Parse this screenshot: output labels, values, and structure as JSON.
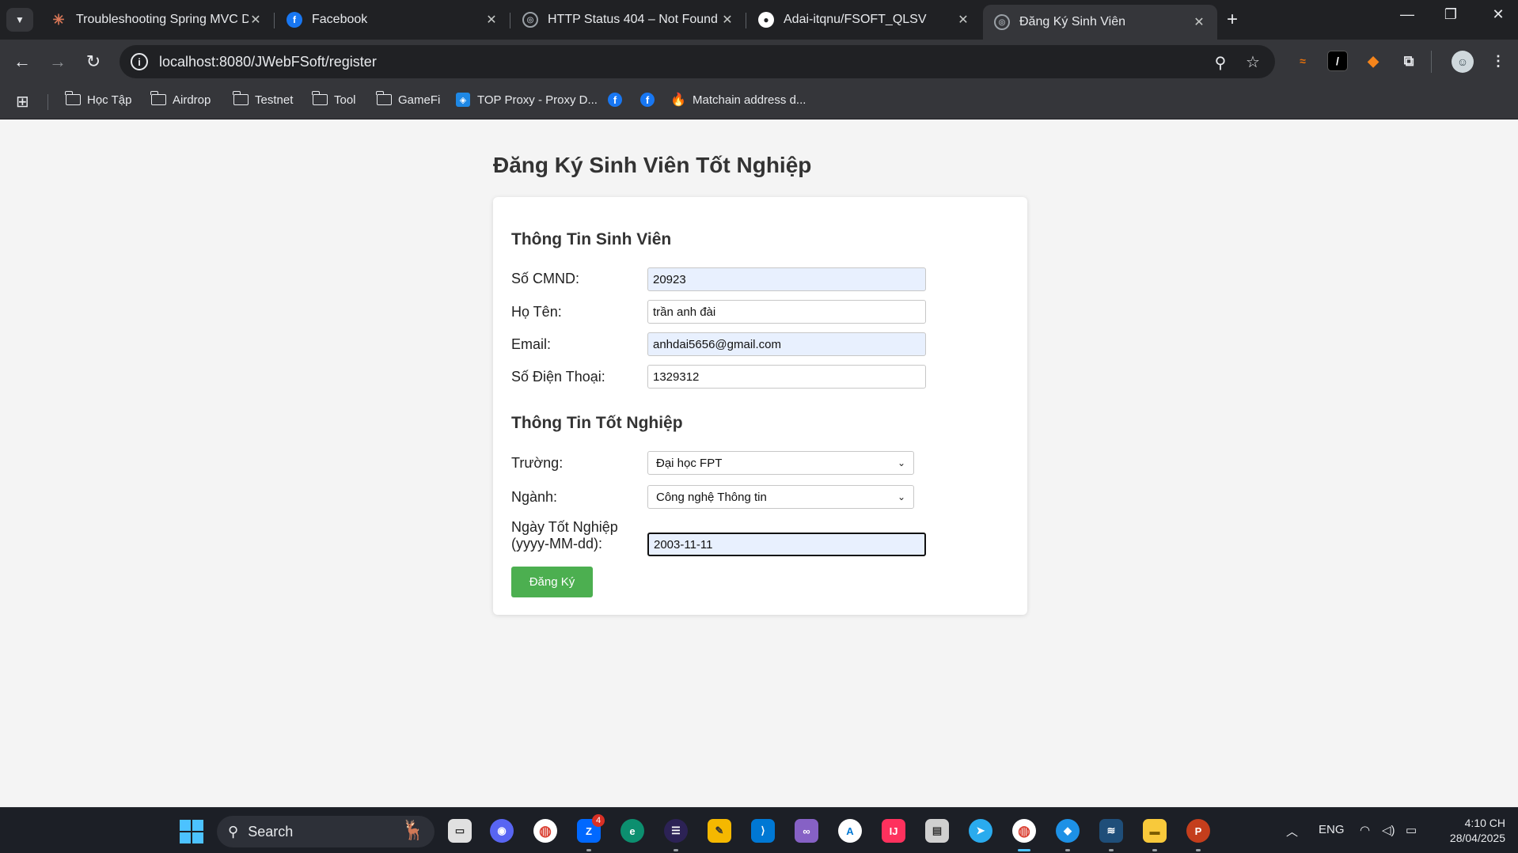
{
  "browser": {
    "tabs": [
      {
        "title": "Troubleshooting Spring MVC D",
        "icon": "claude-icon",
        "color": "#d97757",
        "active": false
      },
      {
        "title": "Facebook",
        "icon": "facebook-icon",
        "color": "#1877f2",
        "active": false
      },
      {
        "title": "HTTP Status 404 – Not Found",
        "icon": "globe-icon",
        "color": "#9aa0a6",
        "active": false
      },
      {
        "title": "Adai-itqnu/FSOFT_QLSV",
        "icon": "github-icon",
        "color": "#ffffff",
        "active": false
      },
      {
        "title": "Đăng Ký Sinh Viên",
        "icon": "globe-icon",
        "color": "#9aa0a6",
        "active": true
      }
    ],
    "address": "localhost:8080/JWebFSoft/register",
    "bookmarks": [
      {
        "label": "Học Tập",
        "icon": "folder-icon"
      },
      {
        "label": "Airdrop",
        "icon": "folder-icon"
      },
      {
        "label": "Testnet",
        "icon": "folder-icon"
      },
      {
        "label": "Tool",
        "icon": "folder-icon"
      },
      {
        "label": "GameFi",
        "icon": "folder-icon"
      },
      {
        "label": "TOP Proxy - Proxy D...",
        "icon": "shield-icon"
      },
      {
        "label": "",
        "icon": "facebook-icon"
      },
      {
        "label": "",
        "icon": "facebook-icon"
      },
      {
        "label": "Matchain address d...",
        "icon": "fire-icon"
      }
    ]
  },
  "page": {
    "title": "Đăng Ký Sinh Viên Tốt Nghiệp",
    "student_section": "Thông Tin Sinh Viên",
    "fields": {
      "cmnd": {
        "label": "Số CMND:",
        "value": "20923"
      },
      "name": {
        "label": "Họ Tên:",
        "value": "trần anh đài"
      },
      "email": {
        "label": "Email:",
        "value": "anhdai5656@gmail.com"
      },
      "phone": {
        "label": "Số Điện Thoại:",
        "value": "1329312"
      }
    },
    "graduation_section": "Thông Tin Tốt Nghiệp",
    "school": {
      "label": "Trường:",
      "value": "Đại học FPT"
    },
    "major": {
      "label": "Ngành:",
      "value": "Công nghệ Thông tin"
    },
    "grad_date": {
      "label_line1": "Ngày Tốt Nghiệp",
      "label_line2": "(yyyy-MM-dd):",
      "value": "2003-11-11"
    },
    "submit_label": "Đăng Ký",
    "accent_color": "#4caf50"
  },
  "taskbar": {
    "search_placeholder": "Search",
    "zalo_badge": "4",
    "language": "ENG",
    "time": "4:10 CH",
    "date": "28/04/2025"
  }
}
